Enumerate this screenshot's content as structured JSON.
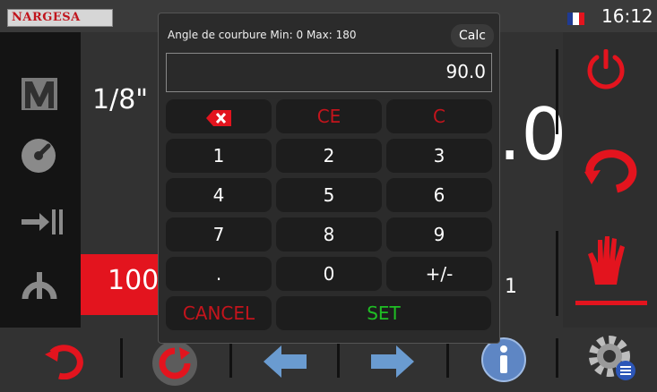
{
  "brand": {
    "logo_text": "NARGESA"
  },
  "status": {
    "time": "16:12",
    "language_flag": {
      "colors": [
        "#1f3a93",
        "#ffffff",
        "#e3141e"
      ]
    }
  },
  "left": {
    "thickness_label": "1/8\"",
    "red_box_value": "100"
  },
  "right": {
    "big_value_partial": ".0",
    "small_value": "1"
  },
  "dialog": {
    "title": "Angle de courbure Min: 0 Max: 180",
    "calc_label": "Calc",
    "value": "90.0",
    "keys": {
      "ce": "CE",
      "c": "C",
      "k1": "1",
      "k2": "2",
      "k3": "3",
      "k4": "4",
      "k5": "5",
      "k6": "6",
      "k7": "7",
      "k8": "8",
      "k9": "9",
      "dot": ".",
      "k0": "0",
      "sign": "+/-",
      "cancel": "CANCEL",
      "set": "SET"
    }
  },
  "colors": {
    "accent_red": "#e3141e",
    "set_green": "#1fbf24",
    "arrow_blue": "#6a9bd0"
  },
  "icons": [
    "manual-mode-icon",
    "gauge-icon",
    "stop-position-icon",
    "arc-icon",
    "power-icon",
    "cycle-icon",
    "hand-icon",
    "rotate-icon",
    "bend-icon",
    "arrow-left-icon",
    "arrow-right-icon",
    "info-icon",
    "settings-icon"
  ]
}
